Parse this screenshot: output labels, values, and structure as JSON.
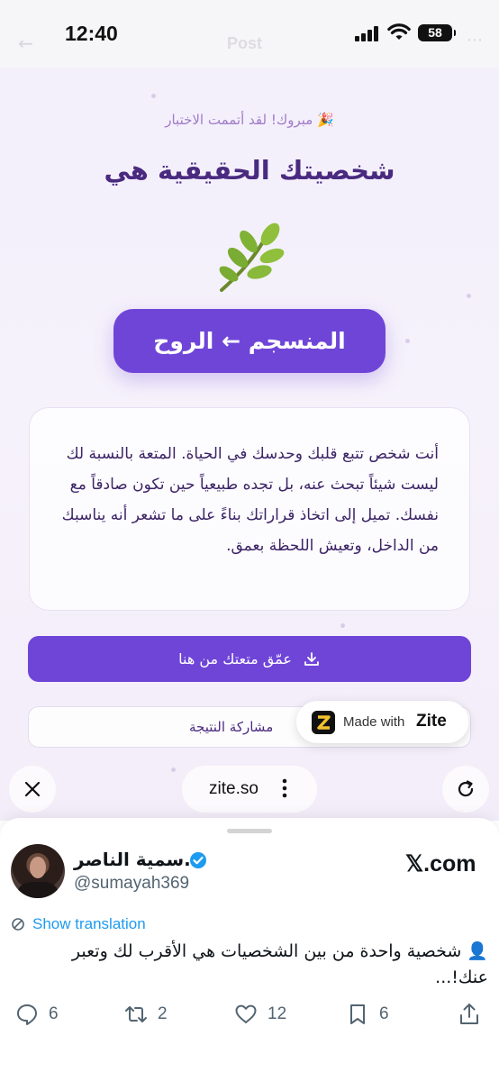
{
  "status_bar": {
    "time": "12:40",
    "battery": "58",
    "ghost_title": "Post"
  },
  "page": {
    "congrats": "🎉 مبروك! لقد أتممت الاختبار",
    "title": "شخصيتك الحقيقية هي",
    "emoji": "leaf-emoji",
    "type_label": "المنسجم ← الروح",
    "description": "أنت شخص تتبع قلبك وحدسك في الحياة. المتعة بالنسبة لك ليست شيئاً تبحث عنه، بل تجده طبيعياً حين تكون صادقاً مع نفسك. تميل إلى اتخاذ قراراتك بناءً على ما تشعر أنه يناسبك من الداخل، وتعيش اللحظة بعمق.",
    "dig_button": "عمّق متعتك من هنا",
    "share_button": "مشاركة النتيجة",
    "accent": "#6f45d8"
  },
  "zite_badge": {
    "made_with": "Made with",
    "name": "Zite"
  },
  "browser": {
    "url": "zite.so"
  },
  "tweet": {
    "display_name": "د.سمية الناصر",
    "handle": "@sumayah369",
    "site": "𝕏.com",
    "show_translation": "Show translation",
    "text": "👤 شخصية واحدة من بين الشخصيات هي الأقرب لك وتعبر عنك!...",
    "replies": "6",
    "reposts": "2",
    "likes": "12",
    "bookmarks": "6"
  }
}
